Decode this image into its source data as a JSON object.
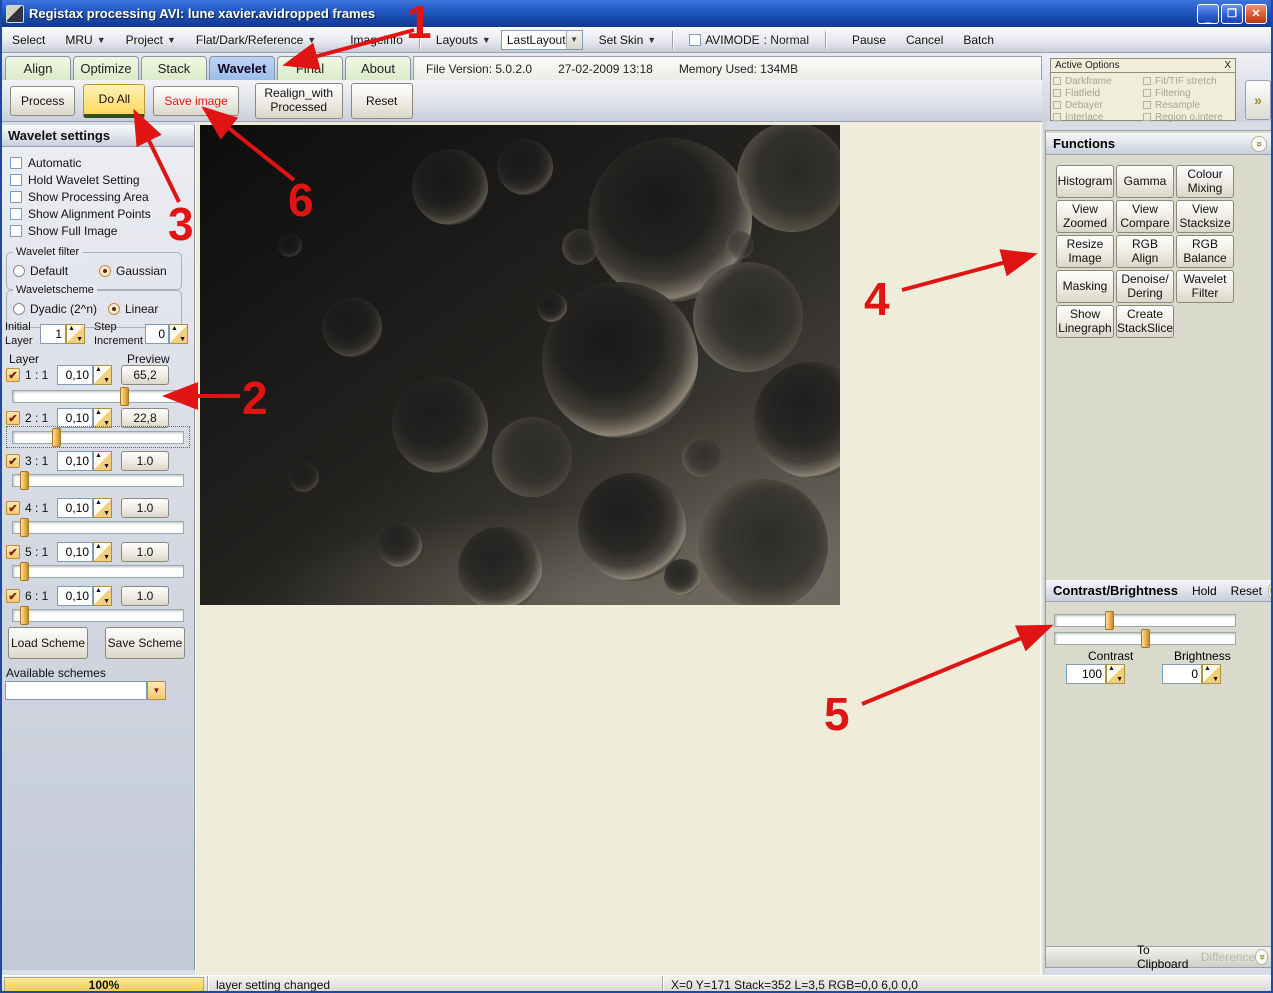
{
  "window": {
    "title": "Registax processing AVI: lune xavier.avidropped frames"
  },
  "icons": {
    "minimize": "_",
    "restore": "❐",
    "close": "✕",
    "dropdown": "▼",
    "combo_arrow": "▼",
    "check": "✔",
    "chevron": "»",
    "spin_up": "▲",
    "spin_down": "▼"
  },
  "menubar": {
    "select": "Select",
    "mru": "MRU",
    "project": "Project",
    "flat_dark_ref": "Flat/Dark/Reference",
    "imageinfo": "Imageinfo",
    "layouts": "Layouts",
    "layout_combo_value": "LastLayout",
    "set_skin": "Set Skin",
    "avimode_label": "AVIMODE",
    "avimode_value": ": Normal",
    "pause": "Pause",
    "cancel": "Cancel",
    "batch": "Batch"
  },
  "tabbar": {
    "tabs": [
      "Align",
      "Optimize",
      "Stack",
      "Wavelet",
      "Final",
      "About"
    ],
    "active_tab": "Wavelet",
    "file_version": "File Version: 5.0.2.0",
    "datetime": "27-02-2009 13:18",
    "memory": "Memory Used: 134MB"
  },
  "toolbar": {
    "process": "Process",
    "do_all": "Do All",
    "save_image": "Save image",
    "realign": "Realign_with Processed",
    "reset": "Reset"
  },
  "active_options": {
    "title": "Active Options",
    "close": "X",
    "left_items": [
      "Darkframe",
      "Flatfield",
      "Debayer",
      "Interlace"
    ],
    "right_items": [
      "Fit/TIF stretch",
      "Filtering",
      "Resample",
      "Region o.intere"
    ]
  },
  "wavelet": {
    "title": "Wavelet settings",
    "options": [
      "Automatic",
      "Hold Wavelet Setting",
      "Show Processing Area",
      "Show Alignment Points",
      "Show Full Image"
    ],
    "filter_label": "Wavelet filter",
    "filter_options": [
      "Default",
      "Gaussian"
    ],
    "filter_selected": "Gaussian",
    "scheme_label": "Waveletscheme",
    "scheme_options": [
      "Dyadic (2^n)",
      "Linear"
    ],
    "scheme_selected": "Linear",
    "initial_layer_label": "Initial Layer",
    "initial_layer_value": "1",
    "step_increment_label": "Step Increment",
    "step_increment_value": "0",
    "layer_col": "Layer",
    "preview_col": "Preview",
    "layers": [
      {
        "name": "1 : 1",
        "value": "0,10",
        "preview": "65,2"
      },
      {
        "name": "2 : 1",
        "value": "0,10",
        "preview": "22,8"
      },
      {
        "name": "3 : 1",
        "value": "0,10",
        "preview": "1.0"
      },
      {
        "name": "4 : 1",
        "value": "0,10",
        "preview": "1.0"
      },
      {
        "name": "5 : 1",
        "value": "0,10",
        "preview": "1.0"
      },
      {
        "name": "6 : 1",
        "value": "0,10",
        "preview": "1.0"
      }
    ],
    "load_scheme": "Load Scheme",
    "save_scheme": "Save Scheme",
    "available_schemes": "Available schemes"
  },
  "functions": {
    "title": "Functions",
    "buttons": [
      "Histogram",
      "Gamma",
      "Colour Mixing",
      "View Zoomed",
      "View Compare",
      "View Stacksize",
      "Resize Image",
      "RGB Align",
      "RGB Balance",
      "Masking",
      "Denoise/ Dering",
      "Wavelet Filter",
      "Show Linegraph",
      "Create StackSlice"
    ]
  },
  "contrast_brightness": {
    "title": "Contrast/Brightness",
    "hold": "Hold",
    "reset": "Reset",
    "contrast_label": "Contrast",
    "contrast_value": "100",
    "brightness_label": "Brightness",
    "brightness_value": "0"
  },
  "clipboard": {
    "label": "To Clipboard",
    "difference": "Difference"
  },
  "statusbar": {
    "progress": "100%",
    "message": "layer setting changed",
    "info": "X=0 Y=171 Stack=352 L=3,5 RGB=0,0 6,0 0,0"
  },
  "annotations": {
    "labels": [
      "1",
      "2",
      "3",
      "4",
      "5",
      "6"
    ]
  }
}
